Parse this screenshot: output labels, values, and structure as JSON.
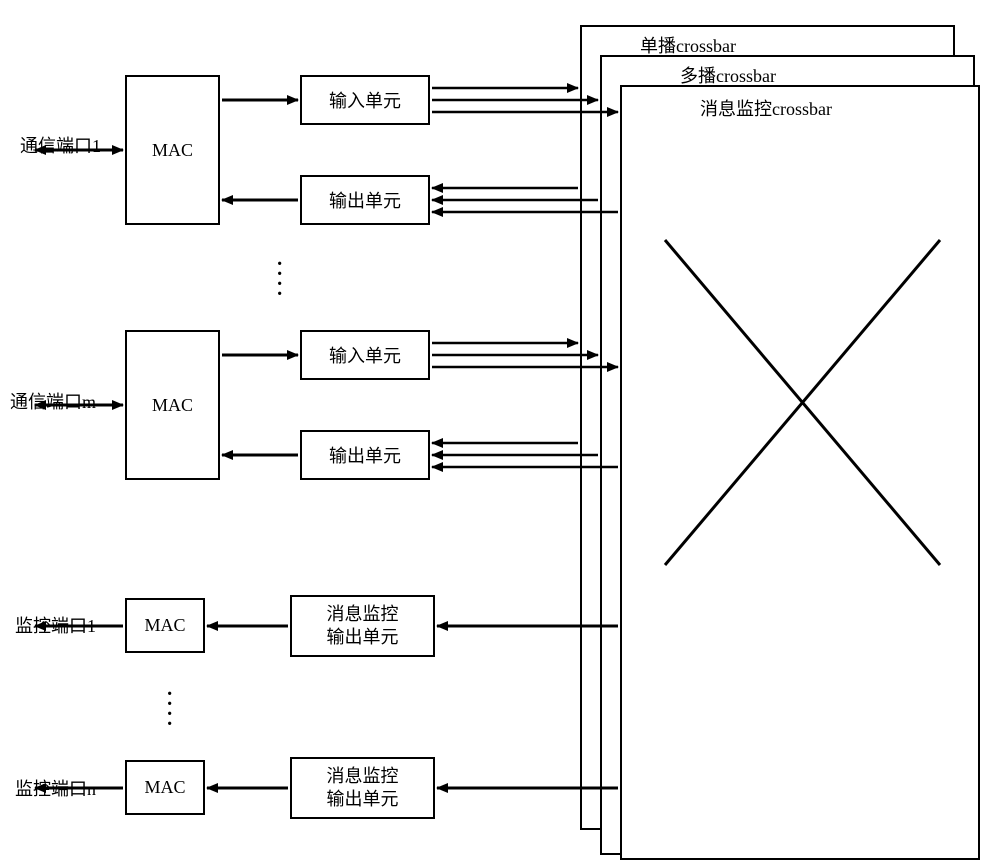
{
  "ports": {
    "comm1": "通信端口1",
    "commM": "通信端口m",
    "mon1": "监控端口1",
    "monN": "监控端口n"
  },
  "blocks": {
    "mac": "MAC",
    "inputUnit": "输入单元",
    "outputUnit": "输出单元",
    "msgMonOutputUnit": "消息监控\n输出单元"
  },
  "crossbars": {
    "unicast": "单播crossbar",
    "multicast": "多播crossbar",
    "msgMon": "消息监控crossbar"
  }
}
